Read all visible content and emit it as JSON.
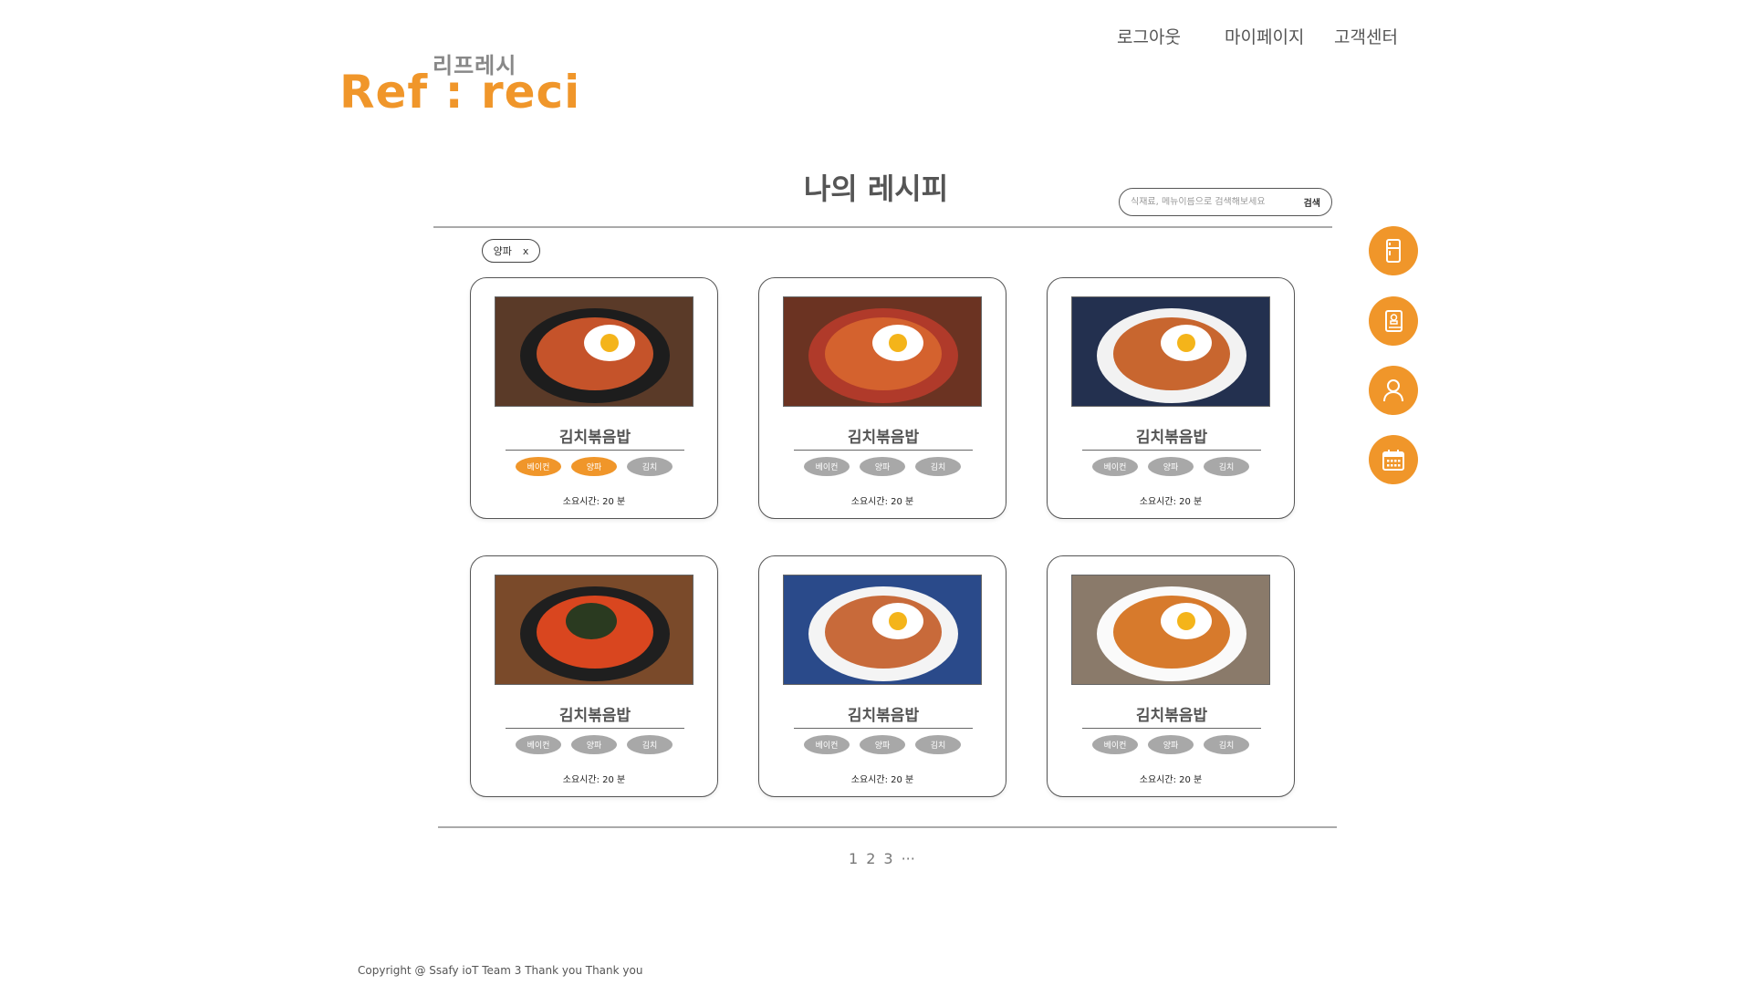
{
  "header": {
    "logo_sub": "리프레시",
    "logo_main": "Ref : reci",
    "nav": {
      "logout": "로그아웃",
      "mypage": "마이페이지",
      "support": "고객센터"
    }
  },
  "main": {
    "title": "나의 레시피",
    "search": {
      "placeholder": "식재료, 메뉴이름으로 검색해보세요",
      "button": "검색"
    },
    "filter_chip": {
      "label": "양파",
      "remove": "x"
    },
    "cards": [
      {
        "title": "김치볶음밥",
        "tags": [
          {
            "label": "베이컨",
            "active": true
          },
          {
            "label": "양파",
            "active": true
          },
          {
            "label": "김치",
            "active": false
          }
        ],
        "time": "소요시간: 20 분"
      },
      {
        "title": "김치볶음밥",
        "tags": [
          {
            "label": "베이컨",
            "active": false
          },
          {
            "label": "양파",
            "active": false
          },
          {
            "label": "김치",
            "active": false
          }
        ],
        "time": "소요시간: 20 분"
      },
      {
        "title": "김치볶음밥",
        "tags": [
          {
            "label": "베이컨",
            "active": false
          },
          {
            "label": "양파",
            "active": false
          },
          {
            "label": "김치",
            "active": false
          }
        ],
        "time": "소요시간: 20 분"
      },
      {
        "title": "김치볶음밥",
        "tags": [
          {
            "label": "베이컨",
            "active": false
          },
          {
            "label": "양파",
            "active": false
          },
          {
            "label": "김치",
            "active": false
          }
        ],
        "time": "소요시간: 20 분"
      },
      {
        "title": "김치볶음밥",
        "tags": [
          {
            "label": "베이컨",
            "active": false
          },
          {
            "label": "양파",
            "active": false
          },
          {
            "label": "김치",
            "active": false
          }
        ],
        "time": "소요시간: 20 분"
      },
      {
        "title": "김치볶음밥",
        "tags": [
          {
            "label": "베이컨",
            "active": false
          },
          {
            "label": "양파",
            "active": false
          },
          {
            "label": "김치",
            "active": false
          }
        ],
        "time": "소요시간: 20 분"
      }
    ],
    "pagination": {
      "pages": [
        "1",
        "2",
        "3"
      ],
      "more": "···"
    }
  },
  "side_menu": [
    {
      "icon": "refrigerator-icon"
    },
    {
      "icon": "recipe-book-icon"
    },
    {
      "icon": "user-icon"
    },
    {
      "icon": "calendar-icon"
    }
  ],
  "footer": {
    "copyright": "Copyright @ Ssafy ioT Team 3 Thank you Thank you"
  },
  "colors": {
    "accent": "#f0962a",
    "tag_inactive": "#a8a8a8",
    "text": "#555555"
  }
}
